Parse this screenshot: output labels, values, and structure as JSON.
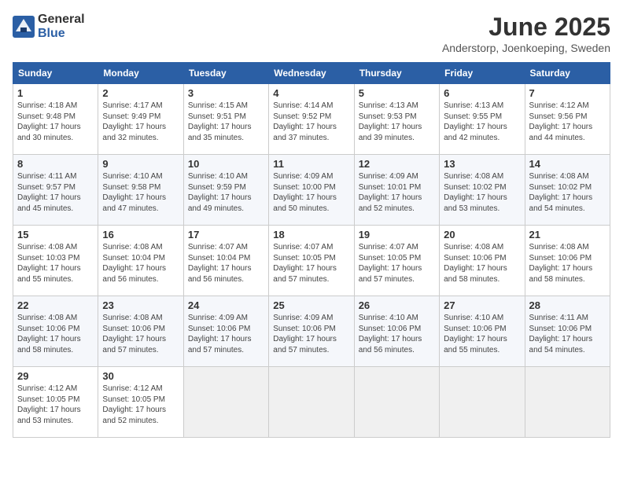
{
  "logo": {
    "general": "General",
    "blue": "Blue"
  },
  "title": "June 2025",
  "location": "Anderstorp, Joenkoeping, Sweden",
  "days_header": [
    "Sunday",
    "Monday",
    "Tuesday",
    "Wednesday",
    "Thursday",
    "Friday",
    "Saturday"
  ],
  "weeks": [
    [
      {
        "day": "1",
        "info": "Sunrise: 4:18 AM\nSunset: 9:48 PM\nDaylight: 17 hours\nand 30 minutes."
      },
      {
        "day": "2",
        "info": "Sunrise: 4:17 AM\nSunset: 9:49 PM\nDaylight: 17 hours\nand 32 minutes."
      },
      {
        "day": "3",
        "info": "Sunrise: 4:15 AM\nSunset: 9:51 PM\nDaylight: 17 hours\nand 35 minutes."
      },
      {
        "day": "4",
        "info": "Sunrise: 4:14 AM\nSunset: 9:52 PM\nDaylight: 17 hours\nand 37 minutes."
      },
      {
        "day": "5",
        "info": "Sunrise: 4:13 AM\nSunset: 9:53 PM\nDaylight: 17 hours\nand 39 minutes."
      },
      {
        "day": "6",
        "info": "Sunrise: 4:13 AM\nSunset: 9:55 PM\nDaylight: 17 hours\nand 42 minutes."
      },
      {
        "day": "7",
        "info": "Sunrise: 4:12 AM\nSunset: 9:56 PM\nDaylight: 17 hours\nand 44 minutes."
      }
    ],
    [
      {
        "day": "8",
        "info": "Sunrise: 4:11 AM\nSunset: 9:57 PM\nDaylight: 17 hours\nand 45 minutes."
      },
      {
        "day": "9",
        "info": "Sunrise: 4:10 AM\nSunset: 9:58 PM\nDaylight: 17 hours\nand 47 minutes."
      },
      {
        "day": "10",
        "info": "Sunrise: 4:10 AM\nSunset: 9:59 PM\nDaylight: 17 hours\nand 49 minutes."
      },
      {
        "day": "11",
        "info": "Sunrise: 4:09 AM\nSunset: 10:00 PM\nDaylight: 17 hours\nand 50 minutes."
      },
      {
        "day": "12",
        "info": "Sunrise: 4:09 AM\nSunset: 10:01 PM\nDaylight: 17 hours\nand 52 minutes."
      },
      {
        "day": "13",
        "info": "Sunrise: 4:08 AM\nSunset: 10:02 PM\nDaylight: 17 hours\nand 53 minutes."
      },
      {
        "day": "14",
        "info": "Sunrise: 4:08 AM\nSunset: 10:02 PM\nDaylight: 17 hours\nand 54 minutes."
      }
    ],
    [
      {
        "day": "15",
        "info": "Sunrise: 4:08 AM\nSunset: 10:03 PM\nDaylight: 17 hours\nand 55 minutes."
      },
      {
        "day": "16",
        "info": "Sunrise: 4:08 AM\nSunset: 10:04 PM\nDaylight: 17 hours\nand 56 minutes."
      },
      {
        "day": "17",
        "info": "Sunrise: 4:07 AM\nSunset: 10:04 PM\nDaylight: 17 hours\nand 56 minutes."
      },
      {
        "day": "18",
        "info": "Sunrise: 4:07 AM\nSunset: 10:05 PM\nDaylight: 17 hours\nand 57 minutes."
      },
      {
        "day": "19",
        "info": "Sunrise: 4:07 AM\nSunset: 10:05 PM\nDaylight: 17 hours\nand 57 minutes."
      },
      {
        "day": "20",
        "info": "Sunrise: 4:08 AM\nSunset: 10:06 PM\nDaylight: 17 hours\nand 58 minutes."
      },
      {
        "day": "21",
        "info": "Sunrise: 4:08 AM\nSunset: 10:06 PM\nDaylight: 17 hours\nand 58 minutes."
      }
    ],
    [
      {
        "day": "22",
        "info": "Sunrise: 4:08 AM\nSunset: 10:06 PM\nDaylight: 17 hours\nand 58 minutes."
      },
      {
        "day": "23",
        "info": "Sunrise: 4:08 AM\nSunset: 10:06 PM\nDaylight: 17 hours\nand 57 minutes."
      },
      {
        "day": "24",
        "info": "Sunrise: 4:09 AM\nSunset: 10:06 PM\nDaylight: 17 hours\nand 57 minutes."
      },
      {
        "day": "25",
        "info": "Sunrise: 4:09 AM\nSunset: 10:06 PM\nDaylight: 17 hours\nand 57 minutes."
      },
      {
        "day": "26",
        "info": "Sunrise: 4:10 AM\nSunset: 10:06 PM\nDaylight: 17 hours\nand 56 minutes."
      },
      {
        "day": "27",
        "info": "Sunrise: 4:10 AM\nSunset: 10:06 PM\nDaylight: 17 hours\nand 55 minutes."
      },
      {
        "day": "28",
        "info": "Sunrise: 4:11 AM\nSunset: 10:06 PM\nDaylight: 17 hours\nand 54 minutes."
      }
    ],
    [
      {
        "day": "29",
        "info": "Sunrise: 4:12 AM\nSunset: 10:05 PM\nDaylight: 17 hours\nand 53 minutes."
      },
      {
        "day": "30",
        "info": "Sunrise: 4:12 AM\nSunset: 10:05 PM\nDaylight: 17 hours\nand 52 minutes."
      },
      {
        "day": "",
        "info": ""
      },
      {
        "day": "",
        "info": ""
      },
      {
        "day": "",
        "info": ""
      },
      {
        "day": "",
        "info": ""
      },
      {
        "day": "",
        "info": ""
      }
    ]
  ]
}
